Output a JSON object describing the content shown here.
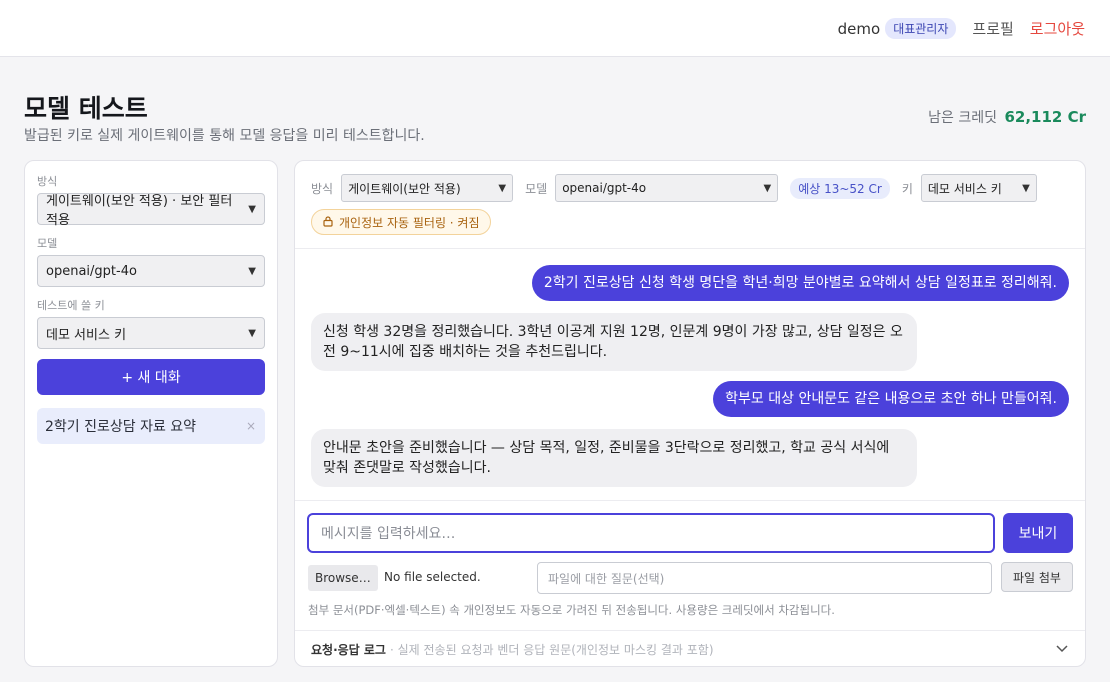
{
  "header": {
    "user": "demo",
    "role": "대표관리자",
    "profile": "프로필",
    "logout": "로그아웃"
  },
  "page": {
    "title": "모델 테스트",
    "subtitle": "발급된 키로 실제 게이트웨이를 통해 모델 응답을 미리 테스트합니다.",
    "credit_label": "남은 크레딧",
    "credit_value": "62,112 Cr"
  },
  "sidebar": {
    "mode_label": "방식",
    "mode_value": "게이트웨이(보안 적용) · 보안 필터 적용",
    "model_label": "모델",
    "model_value": "openai/gpt-4o",
    "key_label": "테스트에 쓸 키",
    "key_value": "데모 서비스 키",
    "new_chat": "+ 새 대화",
    "conversations": [
      {
        "title": "2학기 진로상담 자료 요약",
        "close": "×"
      }
    ]
  },
  "toolbar": {
    "mode_label": "방식",
    "mode_value": "게이트웨이(보안 적용)",
    "model_label": "모델",
    "model_value": "openai/gpt-4o",
    "cost": "예상 13~52 Cr",
    "key_label": "키",
    "key_value": "데모 서비스 키",
    "filter_badge": "개인정보 자동 필터링 · 켜짐"
  },
  "messages": [
    {
      "role": "user",
      "text": "2학기 진로상담 신청 학생 명단을 학년·희망 분야별로 요약해서 상담 일정표로 정리해줘."
    },
    {
      "role": "assistant",
      "text": "신청 학생 32명을 정리했습니다. 3학년 이공계 지원 12명, 인문계 9명이 가장 많고, 상담 일정은 오전 9~11시에 집중 배치하는 것을 추천드립니다."
    },
    {
      "role": "user",
      "text": "학부모 대상 안내문도 같은 내용으로 초안 하나 만들어줘."
    },
    {
      "role": "assistant",
      "text": "안내문 초안을 준비했습니다 — 상담 목적, 일정, 준비물을 3단락으로 정리했고, 학교 공식 서식에 맞춰 존댓말로 작성했습니다."
    }
  ],
  "composer": {
    "placeholder": "메시지를 입력하세요…",
    "send": "보내기",
    "browse": "Browse…",
    "no_file": "No file selected.",
    "file_question_placeholder": "파일에 대한 질문(선택)",
    "attach": "파일 첨부",
    "hint": "첨부 문서(PDF·엑셀·텍스트) 속 개인정보도 자동으로 가려진 뒤 전송됩니다. 사용량은 크레딧에서 차감됩니다."
  },
  "log": {
    "title": "요청·응답 로그",
    "desc": "· 실제 전송된 요청과 벤더 응답 원문(개인정보 마스킹 결과 포함)"
  }
}
